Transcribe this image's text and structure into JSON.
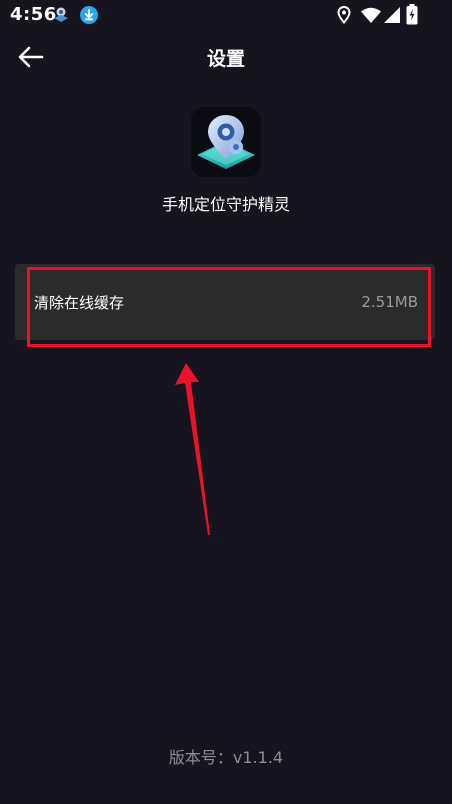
{
  "status_bar": {
    "time": "4:56",
    "icons": [
      "app-notification-icon",
      "download-icon",
      "location-icon",
      "wifi-icon",
      "signal-icon",
      "battery-charging-icon"
    ]
  },
  "header": {
    "title": "设置",
    "back_icon": "arrow-left-icon"
  },
  "app": {
    "name": "手机定位守护精灵",
    "icon": "location-shield-app-icon"
  },
  "settings": {
    "clear_cache": {
      "label": "清除在线缓存",
      "size": "2.51MB"
    }
  },
  "annotation": {
    "color": "#e8132a"
  },
  "footer": {
    "version": "版本号：v1.1.4"
  },
  "colors": {
    "background": "#16141f",
    "row_background": "#2b2b2b",
    "secondary_text": "#9a9a9a",
    "accent": "#2aa8e8"
  }
}
